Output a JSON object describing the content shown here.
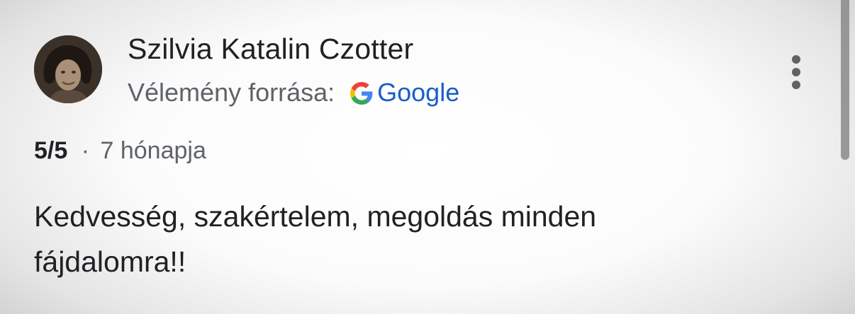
{
  "review": {
    "author_name": "Szilvia Katalin Czotter",
    "source_label": "Vélemény forrása:",
    "source_name": "Google",
    "source_icon": "google-g-icon",
    "rating": "5/5",
    "separator": "·",
    "time_ago": "7 hónapja",
    "text": "Kedvesség, szakértelem, megoldás minden fájdalomra!!",
    "more_icon": "more-vert-icon"
  },
  "colors": {
    "google_link": "#1a5ec8",
    "secondary_text": "#5f6368",
    "primary_text": "#202124"
  }
}
